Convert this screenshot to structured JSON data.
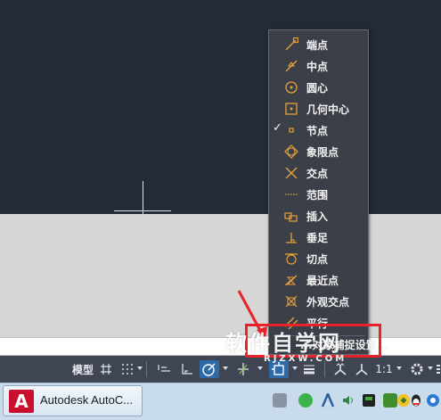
{
  "snap_menu": {
    "items": [
      {
        "label": "端点",
        "icon": "endpoint-icon",
        "checked": false
      },
      {
        "label": "中点",
        "icon": "midpoint-icon",
        "checked": false
      },
      {
        "label": "圆心",
        "icon": "center-icon",
        "checked": false
      },
      {
        "label": "几何中心",
        "icon": "geometric-center-icon",
        "checked": false
      },
      {
        "label": "节点",
        "icon": "node-icon",
        "checked": true
      },
      {
        "label": "象限点",
        "icon": "quadrant-icon",
        "checked": false
      },
      {
        "label": "交点",
        "icon": "intersection-icon",
        "checked": false
      },
      {
        "label": "范围",
        "icon": "extension-icon",
        "checked": false
      },
      {
        "label": "插入",
        "icon": "insertion-icon",
        "checked": false
      },
      {
        "label": "垂足",
        "icon": "perpendicular-icon",
        "checked": false
      },
      {
        "label": "切点",
        "icon": "tangent-icon",
        "checked": false
      },
      {
        "label": "最近点",
        "icon": "nearest-icon",
        "checked": false
      },
      {
        "label": "外观交点",
        "icon": "apparent-intersection-icon",
        "checked": false
      },
      {
        "label": "平行",
        "icon": "parallel-icon",
        "checked": false
      }
    ],
    "check_mark": "✓",
    "settings_label": "...对象捕捉设置..."
  },
  "statusbar": {
    "model_label": "模型",
    "scale_label": "1:1"
  },
  "taskbar": {
    "app_button_label": "Autodesk AutoC...",
    "app_logo_letter": "A"
  },
  "watermark": {
    "main": "软件自学网",
    "sub": "RJZXW.COM"
  },
  "colors": {
    "canvas": "#232a38",
    "menu_bg": "#3b3f48",
    "accent_icon": "#e8a13a",
    "annotation_red": "#e8222a",
    "statusbar_bg": "#3f4553",
    "taskbar_bg": "#c9dcec"
  }
}
